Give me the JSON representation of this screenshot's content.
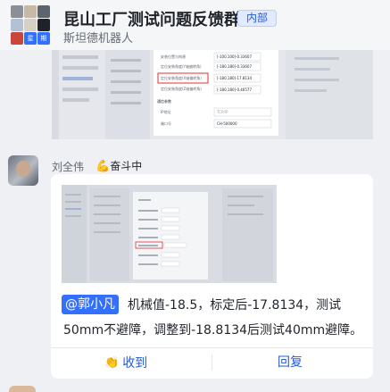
{
  "header": {
    "title": "昆山工厂测试问题反馈群",
    "badge": "内部",
    "subtitle": "斯坦德机器人",
    "avatar_cells": [
      "",
      "",
      "",
      "",
      "",
      "",
      "",
      "星",
      "期"
    ]
  },
  "previous_message": {
    "screenshot": {
      "rows": [
        {
          "label": "安装位置与构建",
          "value": "[-100,100]",
          "value2": "-0.33607"
        },
        {
          "label": "定位安装角度(Y轴偏转角)",
          "value": "[-180,180]",
          "value2": "-0.33607"
        },
        {
          "label": "定位安装角度(X轴偏转角)",
          "value": "[-180,180]",
          "value2": "-17.8134",
          "highlight": true
        },
        {
          "label": "定位安装角度(Z轴偏转角)",
          "value": "[-180,180]",
          "value2": "-0.46577"
        }
      ],
      "section_label": "通信参数",
      "extra_rows": [
        {
          "label": "IP地址",
          "value": "TCP/IP"
        },
        {
          "label": "端口号",
          "value": "CH-500000"
        }
      ]
    }
  },
  "message": {
    "sender": "刘全伟",
    "status_icon": "muscle-icon",
    "status": "奋斗中",
    "mention": "@郭小凡",
    "line1": "机械值-18.5，标定后-17.8134，测试",
    "line2": "50mm不避障，调整到-18.8134后测试40mm避障。",
    "actions": {
      "received": "收到",
      "received_icon": "clap-icon",
      "reply": "回复"
    }
  },
  "colors": {
    "accent": "#245bdb",
    "mention_bg": "#3370ff",
    "highlight": "#e03030"
  }
}
